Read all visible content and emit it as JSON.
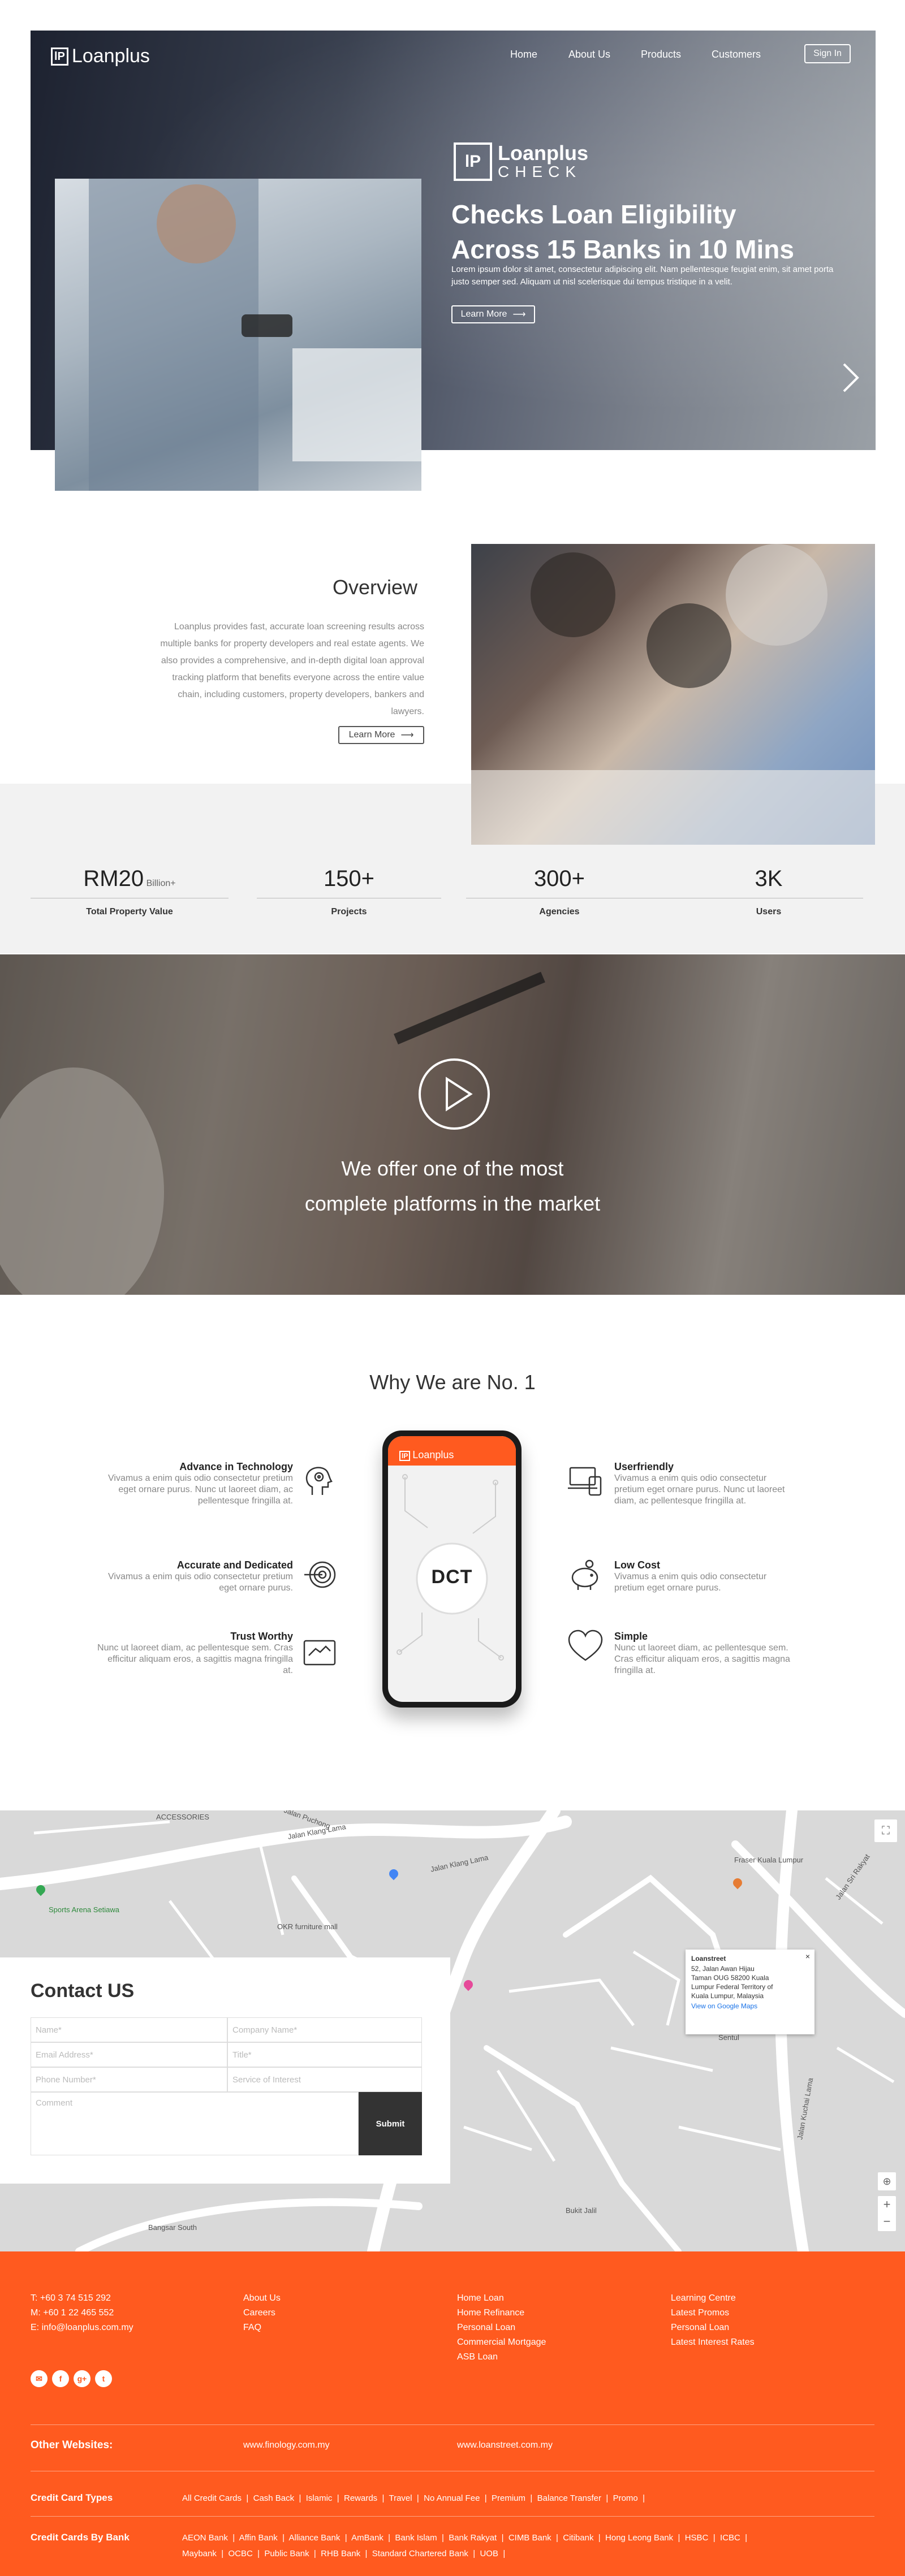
{
  "nav": {
    "logo_text": "Loanplus",
    "links": [
      "Home",
      "About Us",
      "Products",
      "Customers"
    ],
    "sign_in": "Sign In"
  },
  "hero": {
    "badge_logo": "Loanplus",
    "badge_sub": "CHECK",
    "headline_1": "Checks Loan Eligibility",
    "headline_2": "Across 15 Banks in 10 Mins",
    "text": "Lorem ipsum dolor sit amet, consectetur adipiscing elit. Nam pellentesque feugiat enim, sit amet porta justo semper sed. Aliquam ut nisl scelerisque dui tempus tristique in a velit.",
    "cta": "Learn More"
  },
  "overview": {
    "title": "Overview",
    "text": "Loanplus provides fast, accurate loan screening results across multiple banks for property developers and real estate agents. We also provides a comprehensive, and in-depth digital loan approval tracking platform that benefits everyone across the entire value chain, including customers, property developers, bankers and lawyers.",
    "cta": "Learn More"
  },
  "stats": [
    {
      "value": "RM20",
      "suffix": "Billion+",
      "label": "Total Property Value"
    },
    {
      "value": "150+",
      "suffix": "",
      "label": "Projects"
    },
    {
      "value": "300+",
      "suffix": "",
      "label": "Agencies"
    },
    {
      "value": "3K",
      "suffix": "",
      "label": "Users"
    }
  ],
  "video": {
    "line_1": "We offer one of  the most",
    "line_2": "complete platforms in the market"
  },
  "why": {
    "title": "Why We are No. 1",
    "phone_brand": "Loanplus",
    "phone_logo": "DCT",
    "left": [
      {
        "title": "Advance in Technology",
        "desc": "Vivamus a enim quis odio consectetur pretium eget ornare purus. Nunc ut laoreet diam, ac pellentesque fringilla at.",
        "icon": "gear-head-icon"
      },
      {
        "title": "Accurate and Dedicated",
        "desc": "Vivamus a enim quis odio consectetur pretium eget ornare purus.",
        "icon": "target-icon"
      },
      {
        "title": "Trust Worthy",
        "desc": "Nunc ut laoreet diam, ac pellentesque sem. Cras efficitur aliquam eros, a sagittis magna fringilla at.",
        "icon": "handshake-icon"
      }
    ],
    "right": [
      {
        "title": "Userfriendly",
        "desc": "Vivamus a enim quis odio consectetur pretium eget ornare purus. Nunc ut laoreet diam, ac pellentesque fringilla at.",
        "icon": "devices-icon"
      },
      {
        "title": "Low Cost",
        "desc": "Vivamus a enim quis odio consectetur pretium eget ornare purus.",
        "icon": "piggy-bank-icon"
      },
      {
        "title": "Simple",
        "desc": "Nunc ut laoreet diam, ac pellentesque sem. Cras efficitur aliquam eros, a sagittis magna fringilla at.",
        "icon": "heart-icon"
      }
    ]
  },
  "map": {
    "labels": [
      "ACCESSORIES",
      "Jalan Klang Lama",
      "Jalan Puchong",
      "Sports Arena Setiawa",
      "OKR furniture mall",
      "Jalan Klang Lama",
      "Bangsar South",
      "Jalan Kuchai Lama",
      "Jalan Sri Rakyat",
      "Fraser Kuala Lumpur",
      "Sentul",
      "Bukit Jalil"
    ],
    "popup": {
      "name": "Loanstreet",
      "address": "52, Jalan Awan Hijau Taman OUG 58200 Kuala Lumpur Federal Territory of Kuala Lumpur, Malaysia",
      "link": "View on Google Maps"
    }
  },
  "contact": {
    "title": "Contact US",
    "fields": [
      "Name*",
      "Company Name*",
      "Email Address*",
      "Title*",
      "Phone Number*",
      "Service of Interest"
    ],
    "comment": "Comment",
    "submit": "Submit"
  },
  "footer": {
    "phone": "T: +60 3 74 515 292",
    "mobile": "M: +60 1 22 465 552",
    "email": "E: info@loanplus.com.my",
    "col2": [
      "About Us",
      "Careers",
      "FAQ"
    ],
    "col3": [
      "Home Loan",
      "Home Refinance",
      "Personal Loan",
      "Commercial Mortgage",
      "ASB Loan"
    ],
    "col4": [
      "Learning Centre",
      "Latest Promos",
      "Personal Loan",
      "Latest Interest Rates"
    ],
    "other_label": "Other Websites:",
    "other_sites": [
      "www.finology.com.my",
      "www.loanstreet.com.my"
    ],
    "card_types_label": "Credit Card Types",
    "card_types": [
      "All Credit Cards",
      "Cash Back",
      "Islamic",
      "Rewards",
      "Travel",
      "No Annual Fee",
      "Premium",
      "Balance Transfer",
      "Promo"
    ],
    "by_bank_label": "Credit Cards By Bank",
    "banks_row1": [
      "AEON Bank",
      "Affin Bank",
      "Alliance Bank",
      "AmBank",
      "Bank Islam",
      "Bank Rakyat",
      "CIMB Bank",
      "Citibank",
      "Hong Leong Bank",
      "HSBC",
      "ICBC"
    ],
    "banks_row2": [
      "Maybank",
      "OCBC",
      "Public Bank",
      "RHB Bank",
      "Standard Chartered Bank",
      "UOB"
    ]
  },
  "colors": {
    "accent": "#ff5a1f",
    "light_bg": "#f2f2f2"
  }
}
